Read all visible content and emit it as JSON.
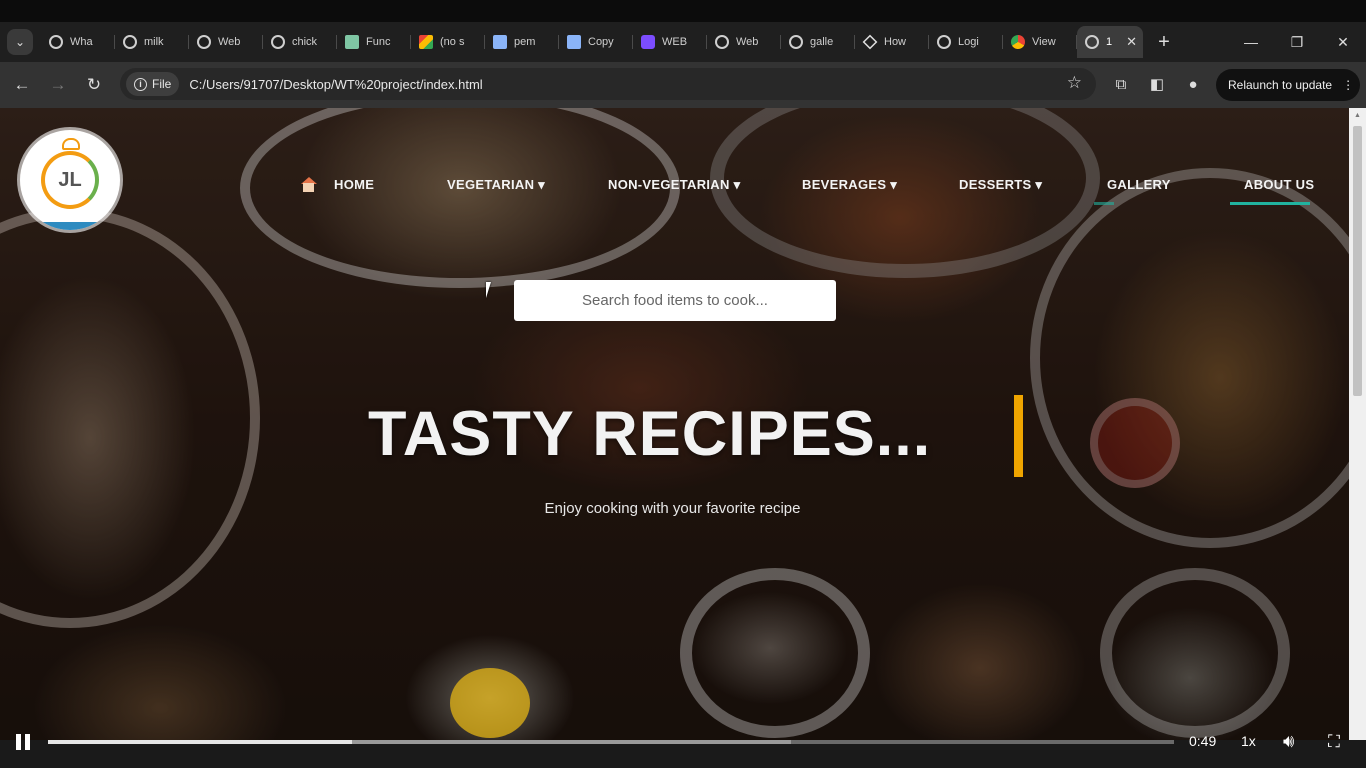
{
  "browser": {
    "tabs": [
      {
        "label": "Wha",
        "icon": "globe-icon"
      },
      {
        "label": "milk",
        "icon": "globe-icon"
      },
      {
        "label": "Web",
        "icon": "globe-icon"
      },
      {
        "label": "chick",
        "icon": "globe-icon"
      },
      {
        "label": "Func",
        "icon": "sheet-icon"
      },
      {
        "label": "(no s",
        "icon": "gmail-icon"
      },
      {
        "label": "pem",
        "icon": "docs-icon"
      },
      {
        "label": "Copy",
        "icon": "docs-icon"
      },
      {
        "label": "WEB",
        "icon": "purple-app-icon"
      },
      {
        "label": "Web",
        "icon": "globe-icon"
      },
      {
        "label": "galle",
        "icon": "globe-icon"
      },
      {
        "label": "How",
        "icon": "move-icon"
      },
      {
        "label": "Logi",
        "icon": "globe-icon"
      },
      {
        "label": "View",
        "icon": "chrome-icon"
      },
      {
        "label": "1",
        "icon": "globe-icon",
        "active": true
      }
    ],
    "new_tab": "+",
    "file_chip": "File",
    "url": "C:/Users/91707/Desktop/WT%20project/index.html",
    "relaunch": "Relaunch to update"
  },
  "site": {
    "logo_text": "JL",
    "nav": {
      "home": "HOME",
      "vegetarian": "VEGETARIAN ▾",
      "non_vegetarian": "NON-VEGETARIAN ▾",
      "beverages": "BEVERAGES ▾",
      "desserts": "DESSERTS ▾",
      "gallery": "GALLERY",
      "about": "ABOUT US"
    },
    "search_placeholder": "Search food items to cook...",
    "hero_title": "TASTY RECIPES...",
    "hero_subtitle": "Enjoy cooking with your favorite recipe"
  },
  "player": {
    "time": "0:49",
    "speed": "1x",
    "progress_fraction": 0.27,
    "buffer_fraction": 0.66
  },
  "colors": {
    "accent_caret": "#f0a500",
    "nav_underline": "#21b3a0"
  }
}
